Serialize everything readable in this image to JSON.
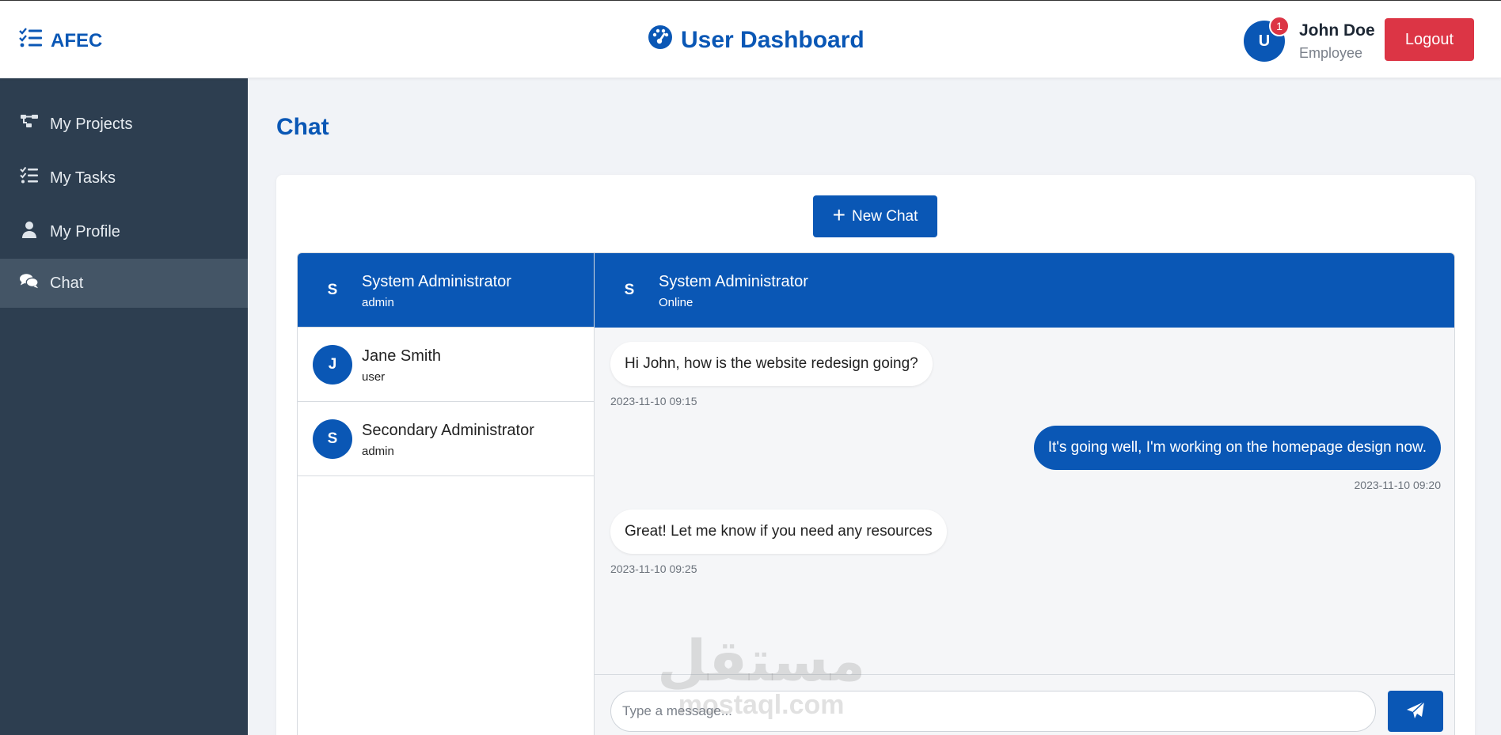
{
  "header": {
    "brand": "AFEC",
    "title": "User Dashboard",
    "avatar_initial": "U",
    "notification_count": "1",
    "user_name": "John Doe",
    "user_role": "Employee",
    "logout_label": "Logout"
  },
  "sidebar": {
    "items": [
      {
        "label": "My Projects",
        "icon": "project-diagram-icon"
      },
      {
        "label": "My Tasks",
        "icon": "tasks-icon"
      },
      {
        "label": "My Profile",
        "icon": "user-icon"
      },
      {
        "label": "Chat",
        "icon": "comments-icon",
        "active": true
      }
    ]
  },
  "main": {
    "page_title": "Chat",
    "new_chat_label": "New Chat",
    "contacts": [
      {
        "initial": "S",
        "name": "System Administrator",
        "role": "admin",
        "active": true
      },
      {
        "initial": "J",
        "name": "Jane Smith",
        "role": "user"
      },
      {
        "initial": "S",
        "name": "Secondary Administrator",
        "role": "admin"
      }
    ],
    "conversation": {
      "initial": "S",
      "name": "System Administrator",
      "status": "Online",
      "messages": [
        {
          "direction": "in",
          "text": "Hi John, how is the website redesign going?",
          "time": "2023-11-10 09:15"
        },
        {
          "direction": "out",
          "text": "It's going well, I'm working on the homepage design now.",
          "time": "2023-11-10 09:20"
        },
        {
          "direction": "in",
          "text": "Great! Let me know if you need any resources",
          "time": "2023-11-10 09:25"
        }
      ],
      "input_placeholder": "Type a message...",
      "input_value": ""
    }
  },
  "watermark": {
    "arabic": "مستقل",
    "latin": "mostaql.com"
  },
  "colors": {
    "primary": "#0a57b5",
    "sidebar": "#2d3e50",
    "sidebar_active": "#445566",
    "danger": "#dc3545"
  }
}
